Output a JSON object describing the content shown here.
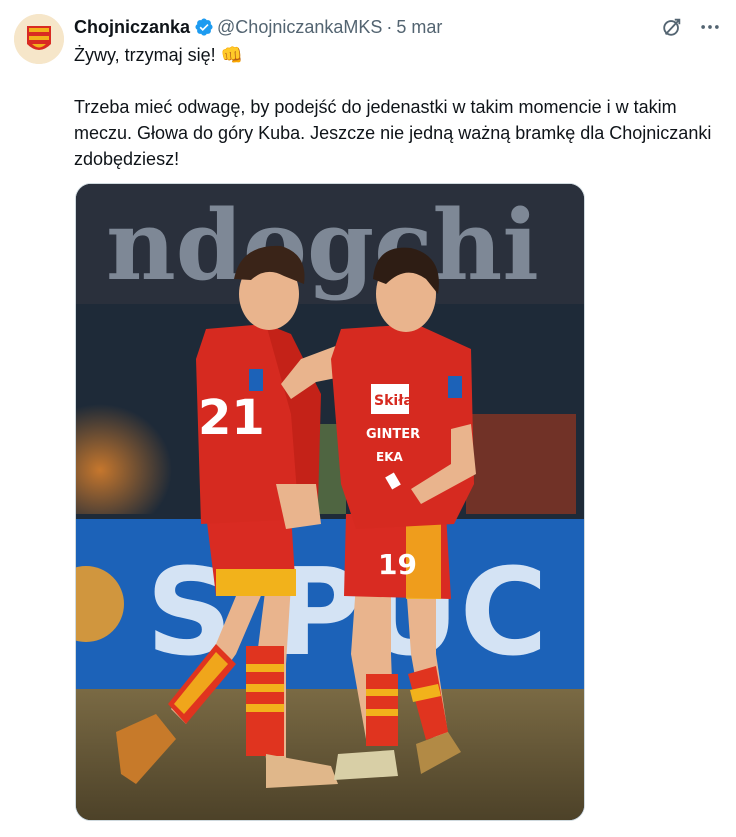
{
  "tweet": {
    "author_name": "Chojniczanka",
    "handle": "@ChojniczankaMKS",
    "separator": "·",
    "date": "5 mar",
    "line1": "Żywy, trzymaj się! 👊",
    "body": "Trzeba mieć odwagę, by podejść do jedenastki w takim momencie i w takim meczu. Głowa do góry Kuba. Jeszcze nie jedną ważną bramkę dla Chojniczanki zdobędziesz!",
    "photo": {
      "banner_text": "ndogchi",
      "board_text": "S PUC",
      "left_shirt_number": "21",
      "right_shirt_number": "19",
      "right_shorts_number": "19",
      "sponsor_1": "Skiła",
      "sponsor_2": "GINTER",
      "sponsor_3": "EKA"
    },
    "colors": {
      "verified": "#1d9bf0",
      "kit_red": "#d92b22",
      "kit_yellow": "#f2b21b",
      "text_secondary": "#536471"
    },
    "icons": [
      "verified-badge-icon",
      "grok-icon",
      "more-icon"
    ]
  }
}
